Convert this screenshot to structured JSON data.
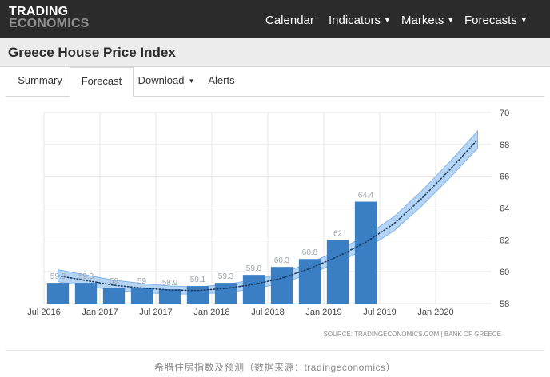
{
  "header": {
    "logo_line1": "TRADING",
    "logo_line2": "ECONOMICS",
    "nav": [
      {
        "label": "Calendar",
        "dropdown": false
      },
      {
        "label": "Indicators",
        "dropdown": true
      },
      {
        "label": "Markets",
        "dropdown": true
      },
      {
        "label": "Forecasts",
        "dropdown": true
      }
    ]
  },
  "page": {
    "title": "Greece House Price Index"
  },
  "tabs": [
    {
      "label": "Summary",
      "active": false
    },
    {
      "label": "Forecast",
      "active": true
    },
    {
      "label": "Download",
      "active": false,
      "dropdown": true
    },
    {
      "label": "Alerts",
      "active": false
    }
  ],
  "chart_data": {
    "type": "bar",
    "categories": [
      "Q3 2016",
      "Q4 2016",
      "Q1 2017",
      "Q2 2017",
      "Q3 2017",
      "Q4 2017",
      "Q1 2018",
      "Q2 2018",
      "Q3 2018",
      "Q4 2018",
      "Q1 2019",
      "Q2 2019"
    ],
    "values": [
      59.3,
      59.3,
      59.0,
      59.0,
      58.9,
      59.1,
      59.3,
      59.8,
      60.3,
      60.8,
      62.0,
      64.4
    ],
    "data_labels": [
      "59.3",
      "59.3",
      "59",
      "59",
      "58.9",
      "59.1",
      "59.3",
      "59.8",
      "60.3",
      "60.8",
      "62",
      "64.4"
    ],
    "forecast": {
      "x": [
        0,
        1,
        2,
        3,
        4,
        5,
        6,
        7,
        8,
        9,
        10,
        11,
        12,
        13,
        14,
        15
      ],
      "y": [
        59.75,
        59.45,
        59.15,
        58.98,
        58.85,
        58.82,
        58.95,
        59.2,
        59.6,
        60.2,
        60.95,
        61.85,
        63.0,
        64.6,
        66.4,
        68.3
      ]
    },
    "x_tick_labels": [
      "Jul 2016",
      "Jan 2017",
      "Jul 2017",
      "Jan 2018",
      "Jul 2018",
      "Jan 2019",
      "Jul 2019",
      "Jan 2020"
    ],
    "y_ticks": [
      58,
      60,
      62,
      64,
      66,
      68,
      70
    ],
    "ylim": [
      58,
      70
    ],
    "y_axis_side": "right",
    "grid": true,
    "source": "SOURCE: TRADINGECONOMICS.COM  |  BANK OF GREECE",
    "colors": {
      "bar": "#3a7fc4",
      "bar_label": "#9aa4ad",
      "band": "#a9ccf2",
      "band_stroke": "#7fb2e8",
      "forecast_line": "#1a3e66",
      "grid": "#e4e4e4",
      "axis_text": "#444444"
    }
  },
  "caption": "希腊住房指数及预测（数据来源：tradingeconomics）"
}
